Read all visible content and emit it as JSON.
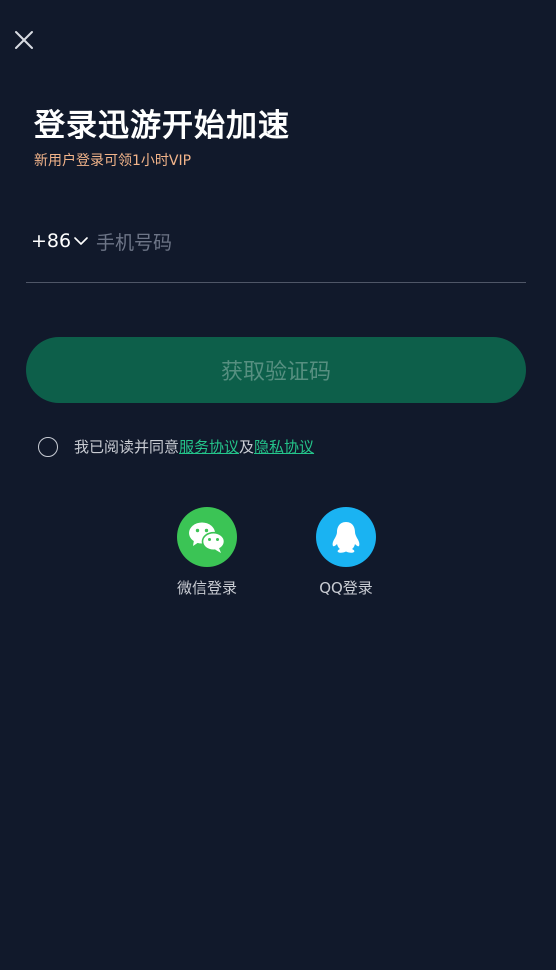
{
  "header": {
    "close_icon": "close-icon"
  },
  "title": "登录迅游开始加速",
  "subtitle": "新用户登录可领1小时VIP",
  "phone": {
    "country_code": "+86",
    "placeholder": "手机号码",
    "value": ""
  },
  "code_button_label": "获取验证码",
  "agreement": {
    "prefix": "我已阅读并同意",
    "service_link": "服务协议",
    "and": "及",
    "privacy_link": "隐私协议",
    "checked": false
  },
  "social_login": [
    {
      "label": "微信登录",
      "icon": "wechat-icon",
      "color": "#3bc455"
    },
    {
      "label": "QQ登录",
      "icon": "qq-icon",
      "color": "#1ab3f2"
    }
  ],
  "colors": {
    "background": "#11192b",
    "accent_orange": "#f2b48a",
    "button_bg": "#0d5f4a",
    "button_text": "#568f80",
    "link_green": "#24c48a"
  }
}
